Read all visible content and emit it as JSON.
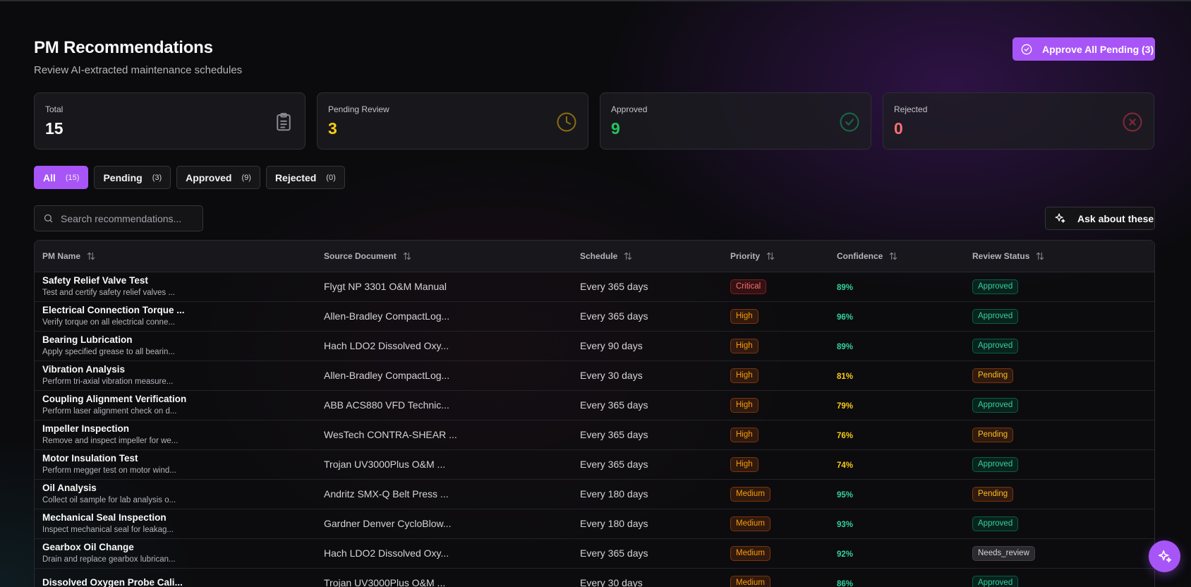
{
  "header": {
    "title": "PM Recommendations",
    "subtitle": "Review AI-extracted maintenance schedules",
    "approve_all_label": "Approve All Pending (3)"
  },
  "stats": [
    {
      "label": "Total",
      "value": "15",
      "icon": "clipboard-icon",
      "color": "#fafafa"
    },
    {
      "label": "Pending Review",
      "value": "3",
      "icon": "clock-icon",
      "color": "#facc15"
    },
    {
      "label": "Approved",
      "value": "9",
      "icon": "check-circle-icon",
      "color": "#22c55e"
    },
    {
      "label": "Rejected",
      "value": "0",
      "icon": "x-circle-icon",
      "color": "#f87171"
    }
  ],
  "filters": [
    {
      "label": "All",
      "count": "(15)",
      "active": true
    },
    {
      "label": "Pending",
      "count": "(3)",
      "active": false
    },
    {
      "label": "Approved",
      "count": "(9)",
      "active": false
    },
    {
      "label": "Rejected",
      "count": "(0)",
      "active": false
    }
  ],
  "search": {
    "placeholder": "Search recommendations...",
    "value": ""
  },
  "ask_label": "Ask about these",
  "table": {
    "columns": [
      "PM Name",
      "Source Document",
      "Schedule",
      "Priority",
      "Confidence",
      "Review Status"
    ],
    "rows": [
      {
        "name": "Safety Relief Valve Test",
        "desc": "Test and certify safety relief valves ...",
        "source": "Flygt NP 3301 O&M Manual",
        "schedule": "Every 365 days",
        "priority": "Critical",
        "confidence": "89%",
        "status": "Approved"
      },
      {
        "name": "Electrical Connection Torque ...",
        "desc": "Verify torque on all electrical conne...",
        "source": "Allen-Bradley CompactLog...",
        "schedule": "Every 365 days",
        "priority": "High",
        "confidence": "96%",
        "status": "Approved"
      },
      {
        "name": "Bearing Lubrication",
        "desc": "Apply specified grease to all bearin...",
        "source": "Hach LDO2 Dissolved Oxy...",
        "schedule": "Every 90 days",
        "priority": "High",
        "confidence": "89%",
        "status": "Approved"
      },
      {
        "name": "Vibration Analysis",
        "desc": "Perform tri-axial vibration measure...",
        "source": "Allen-Bradley CompactLog...",
        "schedule": "Every 30 days",
        "priority": "High",
        "confidence": "81%",
        "status": "Pending"
      },
      {
        "name": "Coupling Alignment Verification",
        "desc": "Perform laser alignment check on d...",
        "source": "ABB ACS880 VFD Technic...",
        "schedule": "Every 365 days",
        "priority": "High",
        "confidence": "79%",
        "status": "Approved"
      },
      {
        "name": "Impeller Inspection",
        "desc": "Remove and inspect impeller for we...",
        "source": "WesTech CONTRA-SHEAR ...",
        "schedule": "Every 365 days",
        "priority": "High",
        "confidence": "76%",
        "status": "Pending"
      },
      {
        "name": "Motor Insulation Test",
        "desc": "Perform megger test on motor wind...",
        "source": "Trojan UV3000Plus O&M ...",
        "schedule": "Every 365 days",
        "priority": "High",
        "confidence": "74%",
        "status": "Approved"
      },
      {
        "name": "Oil Analysis",
        "desc": "Collect oil sample for lab analysis o...",
        "source": "Andritz SMX-Q Belt Press ...",
        "schedule": "Every 180 days",
        "priority": "Medium",
        "confidence": "95%",
        "status": "Pending"
      },
      {
        "name": "Mechanical Seal Inspection",
        "desc": "Inspect mechanical seal for leakag...",
        "source": "Gardner Denver CycloBlow...",
        "schedule": "Every 180 days",
        "priority": "Medium",
        "confidence": "93%",
        "status": "Approved"
      },
      {
        "name": "Gearbox Oil Change",
        "desc": "Drain and replace gearbox lubrican...",
        "source": "Hach LDO2 Dissolved Oxy...",
        "schedule": "Every 365 days",
        "priority": "Medium",
        "confidence": "92%",
        "status": "Needs_review"
      },
      {
        "name": "Dissolved Oxygen Probe Cali...",
        "desc": "",
        "source": "Trojan UV3000Plus O&M ...",
        "schedule": "Every 30 days",
        "priority": "Medium",
        "confidence": "86%",
        "status": "Approved"
      }
    ]
  },
  "colors": {
    "accent": "#a855f7",
    "background": "#0b0b0e"
  }
}
